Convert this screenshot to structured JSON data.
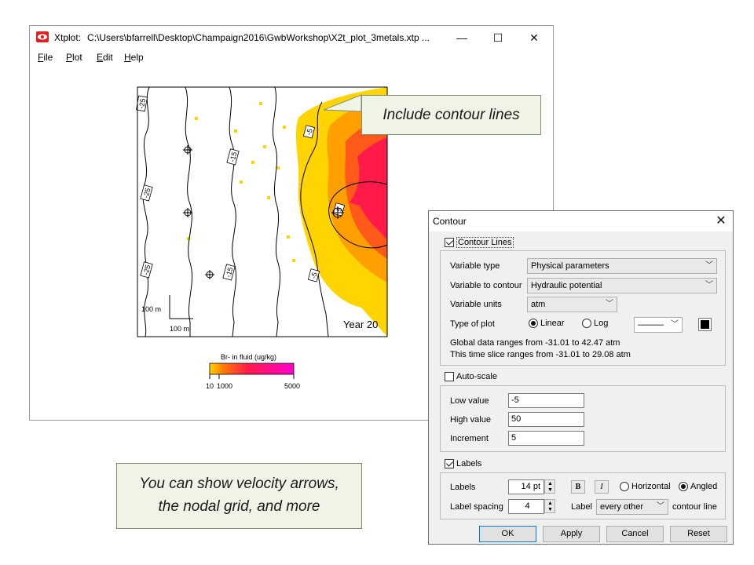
{
  "window": {
    "app_name": "Xtplot:",
    "file_path": "C:\\Users\\bfarrell\\Desktop\\Champaign2016\\GwbWorkshop\\X2t_plot_3metals.xtp ...",
    "controls": {
      "minimize": "—",
      "maximize": "☐",
      "close": "✕"
    },
    "app_icon": "eye-icon",
    "app_icon_color": "#e02020"
  },
  "menu": [
    "File",
    "Plot",
    "Edit",
    "Help"
  ],
  "plot": {
    "year_label": "Year 20",
    "scale_vertical": "100 m",
    "scale_horizontal": "100 m",
    "contour_labels": [
      "-25",
      "-25",
      "-25",
      "-15",
      "-15",
      "-5",
      "-5",
      "5"
    ],
    "legend": {
      "title": "Br- in fluid (ug/kg)",
      "tick_10": "10",
      "tick_1000": "1000",
      "tick_5000": "5000",
      "colors": [
        "#ffd400",
        "#ff8000",
        "#ff1a4a",
        "#ff00cc"
      ]
    }
  },
  "callouts": {
    "top": "Include contour lines",
    "bottom_line1": "You can show velocity arrows,",
    "bottom_line2": "the nodal grid, and more"
  },
  "dialog": {
    "title": "Contour",
    "close": "✕",
    "contour_lines": {
      "label": "Contour Lines",
      "checked": true
    },
    "variable_type_label": "Variable type",
    "variable_type_value": "Physical parameters",
    "variable_contour_label": "Variable to contour",
    "variable_contour_value": "Hydraulic potential",
    "variable_units_label": "Variable units",
    "variable_units_value": "atm",
    "type_of_plot_label": "Type of plot",
    "plot_linear": "Linear",
    "plot_log": "Log",
    "plot_selected": "Linear",
    "line_style": "———",
    "global_range": "Global data ranges from -31.01 to 42.47 atm",
    "slice_range": "This time slice ranges from -31.01 to 29.08 atm",
    "auto_scale": {
      "label": "Auto-scale",
      "checked": false
    },
    "low_label": "Low value",
    "low_value": "-5",
    "high_label": "High value",
    "high_value": "50",
    "increment_label": "Increment",
    "increment_value": "5",
    "labels_check": {
      "label": "Labels",
      "checked": true
    },
    "labels_size_label": "Labels",
    "labels_size_value": "14 pt",
    "bold": "B",
    "italic": "I",
    "orient_horizontal": "Horizontal",
    "orient_angled": "Angled",
    "orient_selected": "Angled",
    "label_spacing_label": "Label spacing",
    "label_spacing_value": "4",
    "label_word": "Label",
    "label_frequency": "every other",
    "contour_line_word": "contour line",
    "buttons": {
      "ok": "OK",
      "apply": "Apply",
      "cancel": "Cancel",
      "reset": "Reset"
    }
  }
}
